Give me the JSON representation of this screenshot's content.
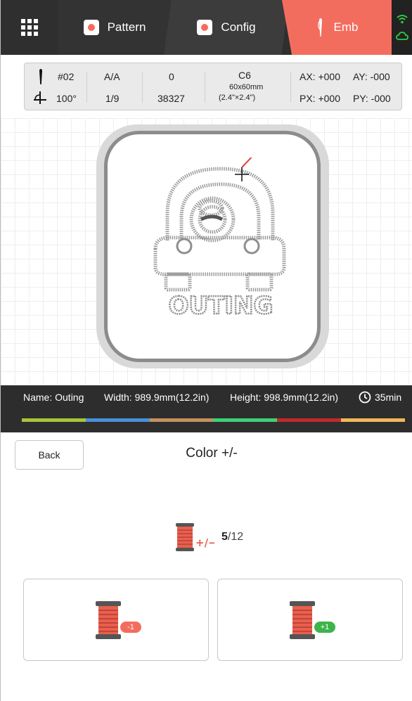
{
  "tabs": {
    "pattern_label": "Pattern",
    "config_label": "Config",
    "emb_label": "Emb",
    "active_color": "#f36d5f"
  },
  "status_icons": [
    "wifi-icon",
    "cloud-icon"
  ],
  "info": {
    "needle": "#02",
    "angle": "100°",
    "aa": "A/A",
    "step": "1/9",
    "zero": "0",
    "stitches": "38327",
    "hoop": "C6",
    "hoop_size": "60x60mm",
    "hoop_size_in": "(2.4\"×2.4\")",
    "ax": "AX: +000",
    "ay": "AY: -000",
    "px": "PX: +000",
    "py": "PY: -000"
  },
  "design": {
    "text": "OUTING"
  },
  "infobar": {
    "name": "Name: Outing",
    "width": "Width: 989.9mm(12.2in)",
    "height": "Height: 998.9mm(12.2in)",
    "time": "35min",
    "thread_colors": [
      "#a8c43a",
      "#4a90d9",
      "#c4915c",
      "#3fd07a",
      "#c02a2a",
      "#f0b85a"
    ]
  },
  "controls": {
    "back_label": "Back",
    "title": "Color +/-",
    "current": "5",
    "total": "/12",
    "minus_badge": "-1",
    "plus_badge": "+1",
    "minus_color": "#f36d5f",
    "plus_color": "#3cb44a"
  }
}
